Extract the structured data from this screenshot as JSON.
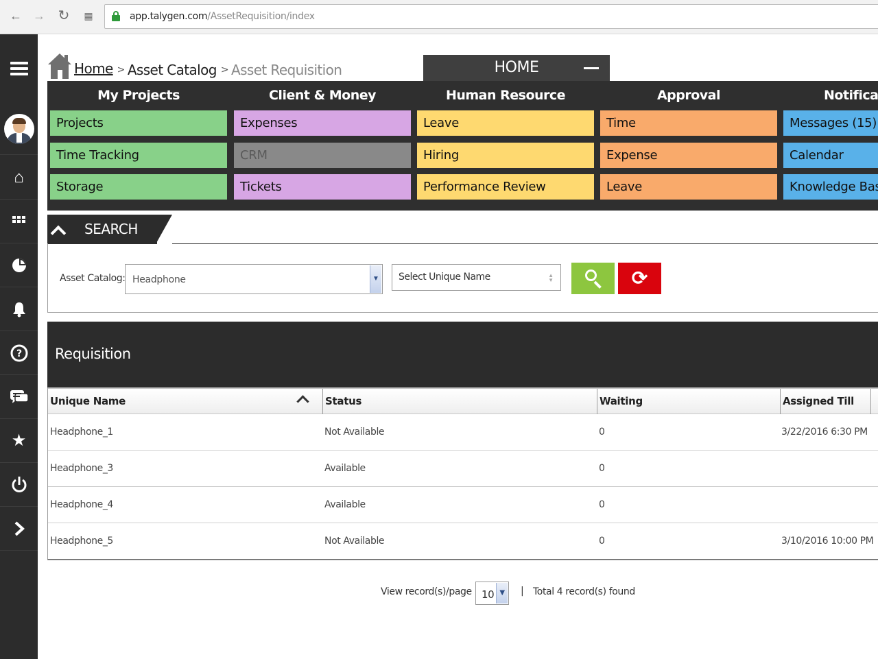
{
  "browser": {
    "url_host": "app.talygen.com",
    "url_path": "/AssetRequisition/index",
    "back_icon": "arrow-left-icon",
    "forward_icon": "arrow-right-icon",
    "reload_icon": "reload-icon",
    "apps_icon": "apps-grid-icon"
  },
  "sidebar": {
    "items": [
      {
        "name": "menu-icon"
      },
      {
        "name": "avatar"
      },
      {
        "name": "home-icon"
      },
      {
        "name": "grid-icon"
      },
      {
        "name": "pie-chart-icon"
      },
      {
        "name": "bell-icon"
      },
      {
        "name": "help-icon"
      },
      {
        "name": "chat-icon"
      },
      {
        "name": "star-icon"
      },
      {
        "name": "power-icon"
      },
      {
        "name": "chevron-right-icon"
      }
    ]
  },
  "breadcrumb": {
    "home": "Home",
    "sep": ">",
    "catalog": "Asset Catalog",
    "current": "Asset Requisition"
  },
  "home_tab": {
    "label": "HOME"
  },
  "menu": {
    "columns": [
      {
        "title": "My Projects",
        "color": "#88d189",
        "items": [
          "Projects",
          "Time Tracking",
          "Storage"
        ]
      },
      {
        "title": "Client & Money",
        "color": "#d7a6e4",
        "items": [
          "Expenses",
          "CRM",
          "Tickets"
        ]
      },
      {
        "title": "Human Resource",
        "color": "#fed970",
        "items": [
          "Leave",
          "Hiring",
          "Performance Review"
        ]
      },
      {
        "title": "Approval",
        "color": "#f9aa6b",
        "items": [
          "Time",
          "Expense",
          "Leave"
        ]
      },
      {
        "title": "Notifications",
        "color": "#59b1e9",
        "items": [
          "Messages (15)",
          "Calendar",
          "Knowledge Base"
        ]
      }
    ],
    "disabled_color": "#898989"
  },
  "search": {
    "title": "SEARCH",
    "asset_catalog_label": "Asset Catalog:",
    "asset_catalog_value": "Headphone",
    "unique_name_placeholder": "Select Unique Name",
    "search_icon": "search-icon",
    "reset_icon": "refresh-icon"
  },
  "requisition": {
    "title": "Requisition",
    "columns": [
      "Unique Name",
      "Status",
      "Waiting",
      "Assigned Till"
    ],
    "rows": [
      {
        "unique_name": "Headphone_1",
        "status": "Not Available",
        "waiting": "0",
        "assigned_till": "3/22/2016 6:30 PM"
      },
      {
        "unique_name": "Headphone_3",
        "status": "Available",
        "waiting": "0",
        "assigned_till": ""
      },
      {
        "unique_name": "Headphone_4",
        "status": "Available",
        "waiting": "0",
        "assigned_till": ""
      },
      {
        "unique_name": "Headphone_5",
        "status": "Not Available",
        "waiting": "0",
        "assigned_till": "3/10/2016 10:00 PM"
      }
    ]
  },
  "pager": {
    "per_page_label": "View record(s)/page",
    "per_page_value": "10",
    "separator": "|",
    "total": "Total 4 record(s) found"
  }
}
